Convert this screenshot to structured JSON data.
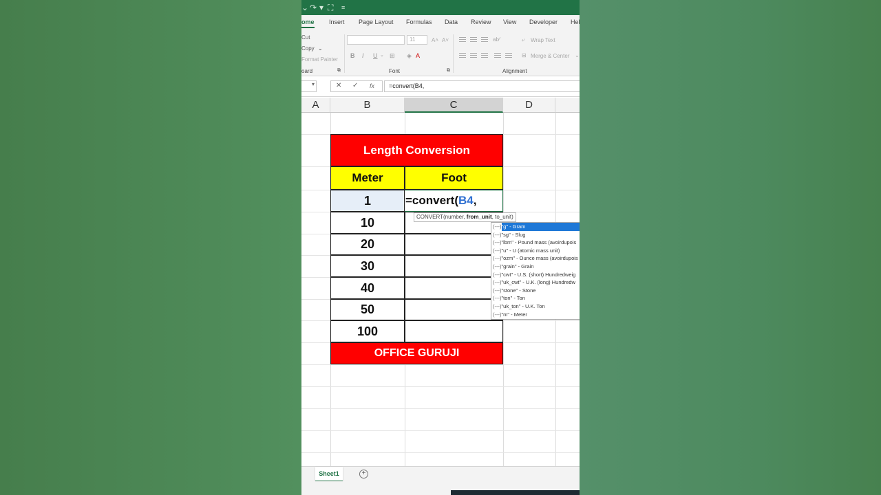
{
  "ribbon": {
    "tabs": [
      "Home",
      "Insert",
      "Page Layout",
      "Formulas",
      "Data",
      "Review",
      "View",
      "Developer",
      "Help"
    ],
    "tabs_visible": [
      "ome",
      "Insert",
      "Page Layout",
      "Formulas",
      "Data",
      "Review",
      "View",
      "Developer",
      "Hel"
    ],
    "clipboard": {
      "cut": "Cut",
      "copy": "Copy",
      "format_painter": "Format Painter",
      "group_label": "oard"
    },
    "font": {
      "font_size": "11",
      "bold": "B",
      "italic": "I",
      "underline": "U",
      "group_label": "Font"
    },
    "alignment": {
      "wrap_text": "Wrap Text",
      "merge_center": "Merge & Center",
      "group_label": "Alignment"
    }
  },
  "formula_bar": {
    "cancel": "✕",
    "enter": "✓",
    "fx": "fx",
    "value": "=convert(B4,"
  },
  "columns": [
    "A",
    "B",
    "C",
    "D"
  ],
  "table": {
    "title": "Length Conversion",
    "header_meter": "Meter",
    "header_foot": "Foot",
    "meters": [
      "1",
      "10",
      "20",
      "30",
      "40",
      "50",
      "100"
    ],
    "formula_prefix": "=convert(",
    "formula_ref": "B4",
    "formula_suffix": ",",
    "footer": "OFFICE GURUJI"
  },
  "tooltip": {
    "fn": "CONVERT(number, ",
    "bold": "from_unit",
    ".": "",
    "rest": ", to_unit)"
  },
  "autocomplete": [
    "\"g\" - Gram",
    "\"sg\" - Slug",
    "\"lbm\" - Pound mass (avoirdupois",
    "\"u\" - U (atomic mass unit)",
    "\"ozm\" - Ounce mass (avoirdupois",
    "\"grain\" - Grain",
    "\"cwt\" - U.S. (short) Hundredweig",
    "\"uk_cwt\" - U.K. (long) Hundredw",
    "\"stone\" - Stone",
    "\"ton\" - Ton",
    "\"uk_ton\" - U.K. Ton",
    "\"m\" - Meter"
  ],
  "autocomplete_prefix": "(---)",
  "sheet": {
    "tab": "Sheet1",
    "add": "+"
  },
  "colors": {
    "excel_green": "#217346",
    "title_red": "#ff0000",
    "header_yellow": "#ffff00",
    "ref_blue": "#2f6fd1"
  }
}
